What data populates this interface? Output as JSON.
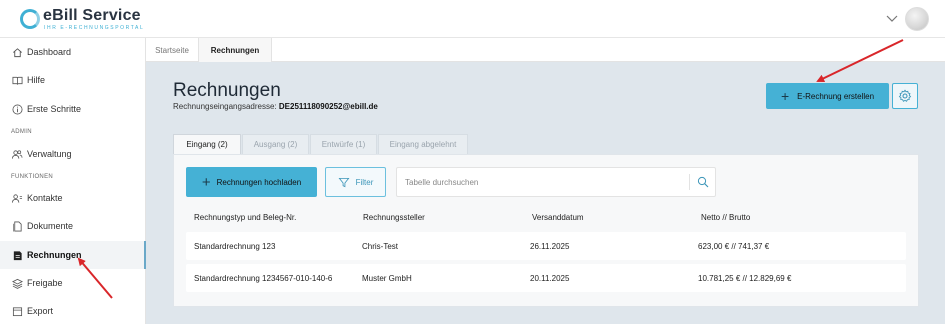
{
  "header": {
    "logo_title": "eBill Service",
    "logo_subtitle": "IHR E-RECHNUNGSPORTAL"
  },
  "sidebar": {
    "items": [
      {
        "label": "Dashboard",
        "icon": "home-icon"
      },
      {
        "label": "Hilfe",
        "icon": "book-icon"
      },
      {
        "label": "Erste Schritte",
        "icon": "info-icon"
      },
      {
        "label": "Verwaltung",
        "icon": "users-icon"
      },
      {
        "label": "Kontakte",
        "icon": "contacts-icon"
      },
      {
        "label": "Dokumente",
        "icon": "document-icon"
      },
      {
        "label": "Rechnungen",
        "icon": "invoice-icon"
      },
      {
        "label": "Freigabe",
        "icon": "layers-icon"
      },
      {
        "label": "Export",
        "icon": "export-icon"
      }
    ],
    "section_admin": "ADMIN",
    "section_funktionen": "FUNKTIONEN",
    "active_item": "Rechnungen"
  },
  "tabs": [
    {
      "label": "Startseite"
    },
    {
      "label": "Rechnungen"
    }
  ],
  "page": {
    "title": "Rechnungen",
    "address_label": "Rechnungseingangsadresse:",
    "address_value": "DE251118090252@ebill.de",
    "create_button": "E-Rechnung erstellen"
  },
  "subtabs": [
    {
      "label": "Eingang (2)"
    },
    {
      "label": "Ausgang (2)"
    },
    {
      "label": "Entwürfe (1)"
    },
    {
      "label": "Eingang abgelehnt"
    }
  ],
  "toolbar": {
    "upload_label": "Rechnungen hochladen",
    "filter_label": "Filter",
    "search_placeholder": "Tabelle durchsuchen"
  },
  "table": {
    "columns": [
      "Rechnungstyp und Beleg-Nr.",
      "Rechnungssteller",
      "Versanddatum",
      "Netto // Brutto"
    ],
    "rows": [
      [
        "Standardrechnung 123",
        "Chris-Test",
        "26.11.2025",
        "623,00 € // 741,37 €"
      ],
      [
        "Standardrechnung 1234567-010-140-6",
        "Muster GmbH",
        "20.11.2025",
        "10.781,25 € // 12.829,69 €"
      ]
    ]
  },
  "colors": {
    "accent": "#45b1d5",
    "main_bg": "#dfe6ec",
    "annotation_arrow": "#d9262a"
  }
}
